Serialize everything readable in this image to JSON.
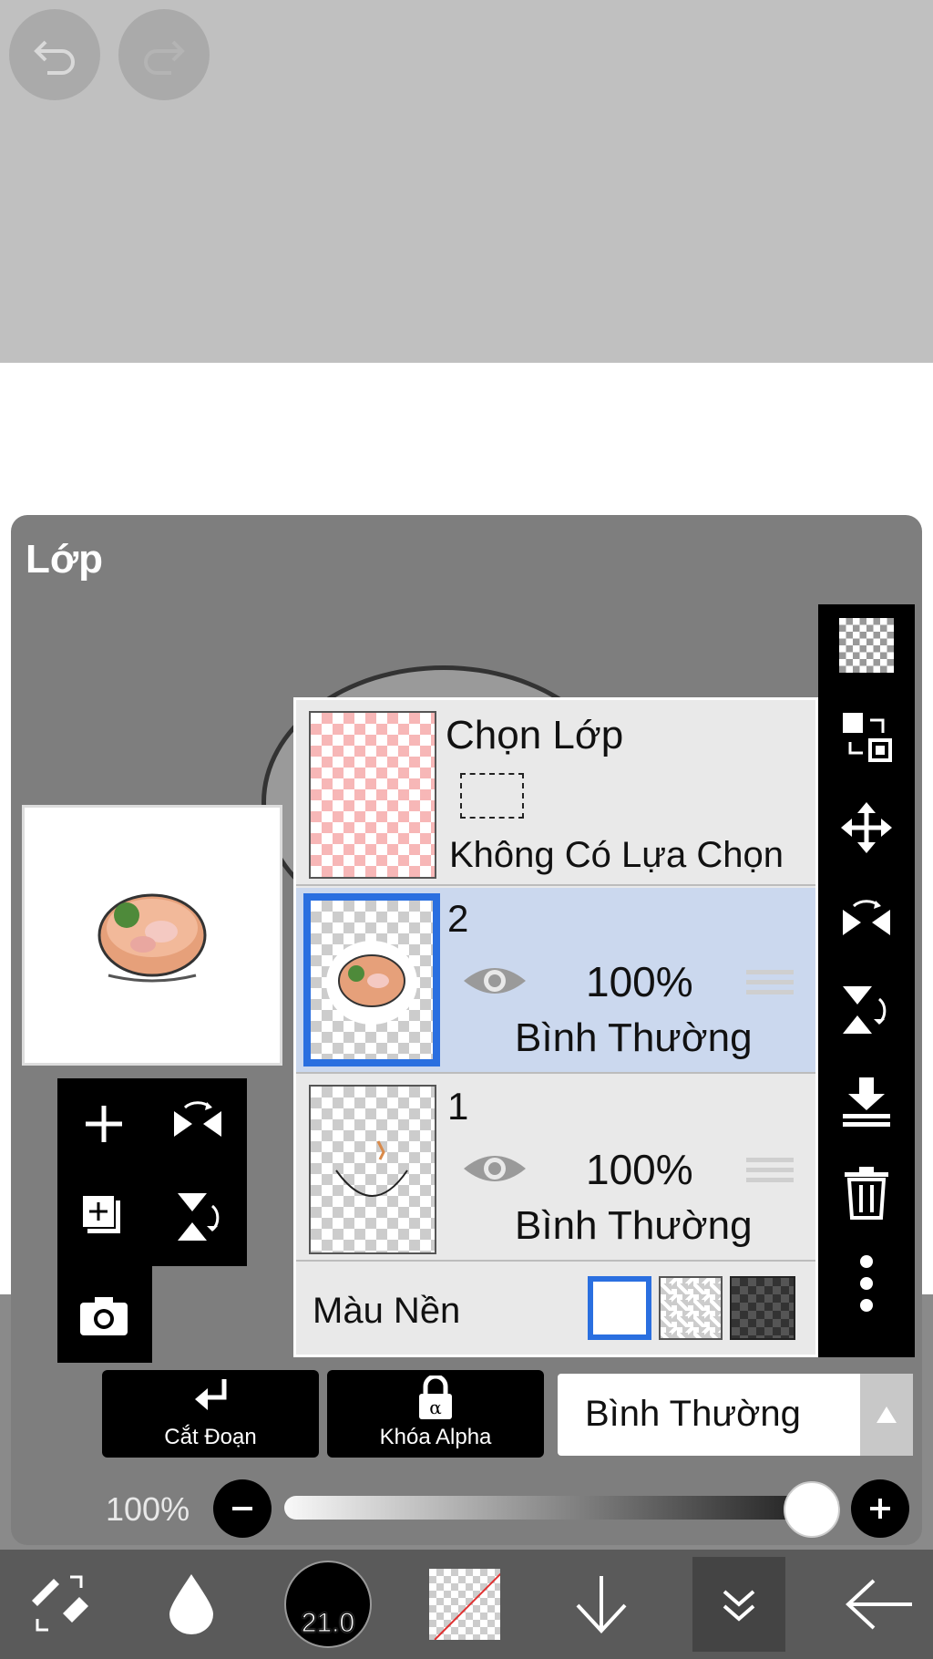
{
  "header": {
    "undo_icon": "undo-icon",
    "redo_icon": "redo-icon"
  },
  "layer_panel": {
    "title": "Lớp",
    "selection_layer": {
      "title": "Chọn Lớp",
      "subtitle": "Không Có Lựa Chọn"
    },
    "layers": [
      {
        "number": "2",
        "opacity": "100%",
        "blend": "Bình Thường",
        "selected": true
      },
      {
        "number": "1",
        "opacity": "100%",
        "blend": "Bình Thường",
        "selected": false
      }
    ],
    "background": {
      "label": "Màu Nền",
      "options": [
        "white",
        "transparent",
        "dark-checker"
      ],
      "selected": "white"
    }
  },
  "actions": {
    "clipping_label": "Cắt Đoạn",
    "alpha_lock_label": "Khóa Alpha",
    "blend_mode": "Bình Thường"
  },
  "opacity": {
    "label": "100%",
    "value": 1.0
  },
  "bottom_bar": {
    "brush_size": "21.0"
  },
  "colors": {
    "accent": "#2a6fe0",
    "selected_row": "#cbd8ee",
    "panel": "#7e7e7e",
    "toolbar": "#000000",
    "line": "#e03030"
  }
}
